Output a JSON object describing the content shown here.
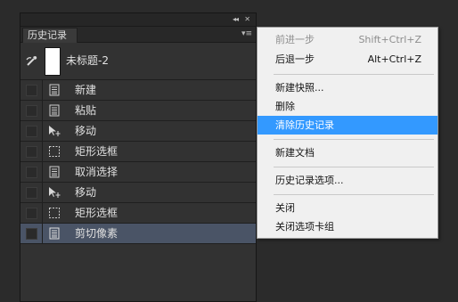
{
  "panel": {
    "collapse_glyph": "◂◂",
    "close_glyph": "✕",
    "tab_label": "历史记录",
    "menu_glyph": "▾≡",
    "snapshot": {
      "label": "未标题-2",
      "icon": "history-brush-icon"
    },
    "rows": [
      {
        "label": "新建",
        "icon": "document-icon",
        "selected": false
      },
      {
        "label": "粘贴",
        "icon": "document-icon",
        "selected": false
      },
      {
        "label": "移动",
        "icon": "move-tool-icon",
        "selected": false
      },
      {
        "label": "矩形选框",
        "icon": "rect-marquee-icon",
        "selected": false
      },
      {
        "label": "取消选择",
        "icon": "document-icon",
        "selected": false
      },
      {
        "label": "移动",
        "icon": "move-tool-icon",
        "selected": false
      },
      {
        "label": "矩形选框",
        "icon": "rect-marquee-icon",
        "selected": false
      },
      {
        "label": "剪切像素",
        "icon": "document-icon",
        "selected": true
      }
    ]
  },
  "menu": {
    "items": [
      {
        "label": "前进一步",
        "shortcut": "Shift+Ctrl+Z",
        "disabled": true
      },
      {
        "label": "后退一步",
        "shortcut": "Alt+Ctrl+Z",
        "disabled": false
      },
      {
        "label": "新建快照...",
        "shortcut": "",
        "disabled": false
      },
      {
        "label": "删除",
        "shortcut": "",
        "disabled": false
      },
      {
        "label": "清除历史记录",
        "shortcut": "",
        "disabled": false,
        "highlighted": true
      },
      {
        "label": "新建文档",
        "shortcut": "",
        "disabled": false
      },
      {
        "label": "历史记录选项...",
        "shortcut": "",
        "disabled": false
      },
      {
        "label": "关闭",
        "shortcut": "",
        "disabled": false
      },
      {
        "label": "关闭选项卡组",
        "shortcut": "",
        "disabled": false
      }
    ]
  },
  "colors": {
    "panel_bg": "#323232",
    "selected_row": "#4a5466",
    "menu_bg": "#f0f0f0",
    "menu_highlight": "#3399ff",
    "menu_disabled_text": "#8d8d8d"
  }
}
